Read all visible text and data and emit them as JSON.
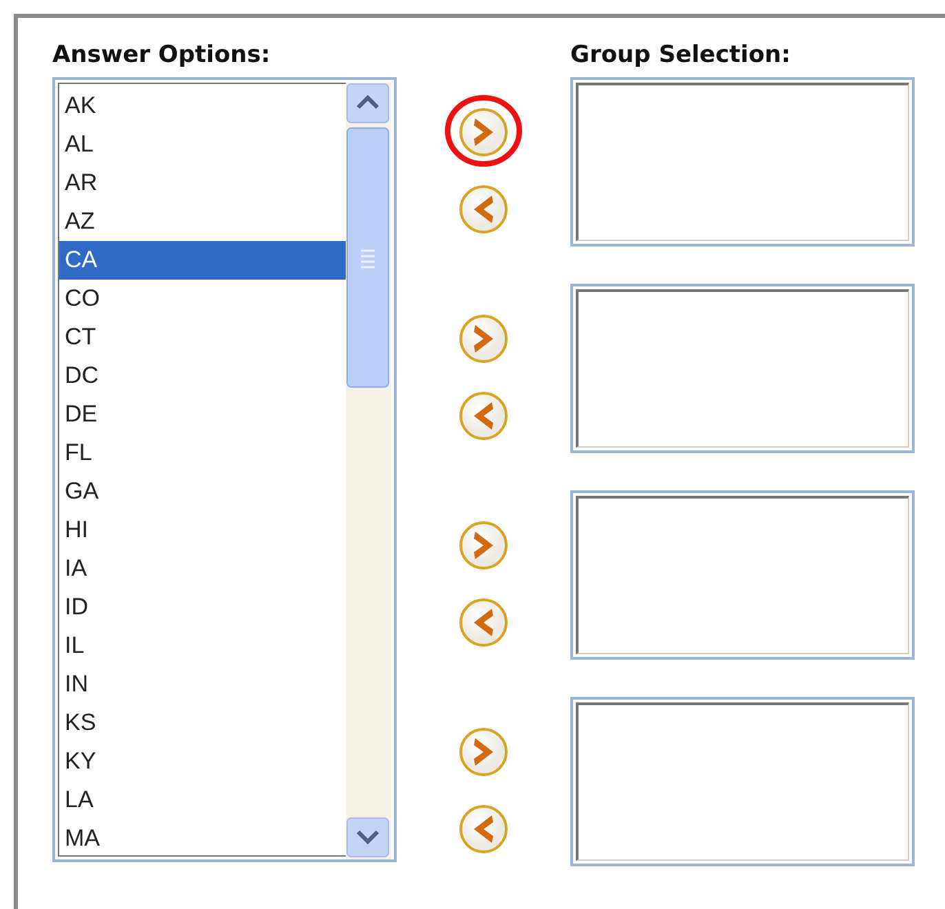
{
  "answer_options": {
    "heading": "Answer Options:",
    "options": [
      {
        "label": "AK",
        "selected": false
      },
      {
        "label": "AL",
        "selected": false
      },
      {
        "label": "AR",
        "selected": false
      },
      {
        "label": "AZ",
        "selected": false
      },
      {
        "label": "CA",
        "selected": true
      },
      {
        "label": "CO",
        "selected": false
      },
      {
        "label": "CT",
        "selected": false
      },
      {
        "label": "DC",
        "selected": false
      },
      {
        "label": "DE",
        "selected": false
      },
      {
        "label": "FL",
        "selected": false
      },
      {
        "label": "GA",
        "selected": false
      },
      {
        "label": "HI",
        "selected": false
      },
      {
        "label": "IA",
        "selected": false
      },
      {
        "label": "ID",
        "selected": false
      },
      {
        "label": "IL",
        "selected": false
      },
      {
        "label": "IN",
        "selected": false
      },
      {
        "label": "KS",
        "selected": false
      },
      {
        "label": "KY",
        "selected": false
      },
      {
        "label": "LA",
        "selected": false
      },
      {
        "label": "MA",
        "selected": false
      }
    ]
  },
  "group_selection": {
    "heading": "Group Selection:",
    "groups": [
      {
        "buttons": [
          {
            "kind": "add",
            "circled": true
          },
          {
            "kind": "remove",
            "circled": false
          }
        ]
      },
      {
        "buttons": [
          {
            "kind": "add",
            "circled": false
          },
          {
            "kind": "remove",
            "circled": false
          }
        ]
      },
      {
        "buttons": [
          {
            "kind": "add",
            "circled": false
          },
          {
            "kind": "remove",
            "circled": false
          }
        ]
      },
      {
        "buttons": [
          {
            "kind": "add",
            "circled": false
          },
          {
            "kind": "remove",
            "circled": false
          }
        ]
      }
    ]
  }
}
